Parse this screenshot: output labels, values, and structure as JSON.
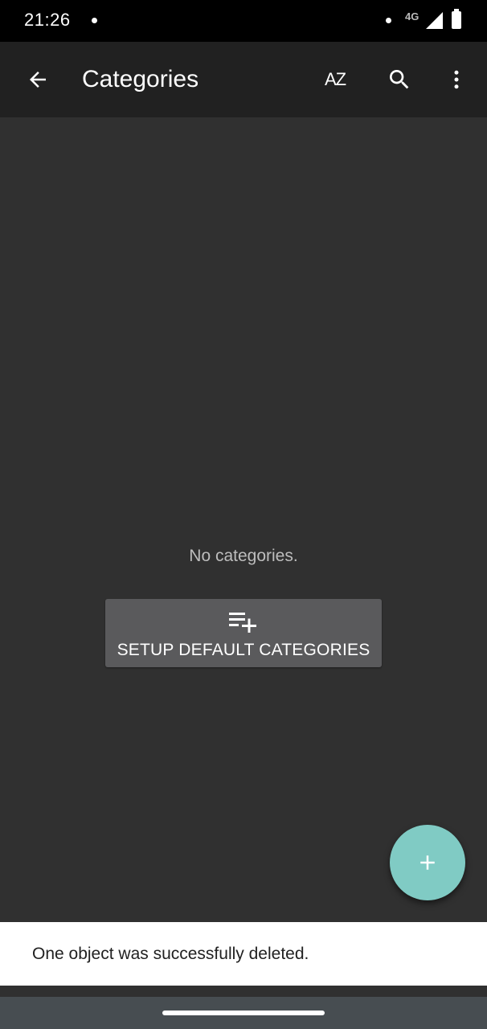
{
  "status_bar": {
    "time": "21:26",
    "network": "4G"
  },
  "app_bar": {
    "title": "Categories",
    "back_icon": "arrow-left-icon",
    "sort_icon": "sort-alphabetical-icon",
    "sort_label": "AZ",
    "search_icon": "search-icon",
    "menu_icon": "more-vert-icon"
  },
  "empty_state": {
    "message": "No categories.",
    "setup_button_label": "SETUP DEFAULT CATEGORIES",
    "setup_icon": "playlist-add-icon"
  },
  "fab": {
    "icon": "plus-icon",
    "color": "#80cbc4"
  },
  "snackbar": {
    "message": "One object was successfully deleted."
  },
  "colors": {
    "background": "#303030",
    "app_bar": "#212121",
    "button": "#5a5a5c",
    "accent": "#80cbc4"
  }
}
